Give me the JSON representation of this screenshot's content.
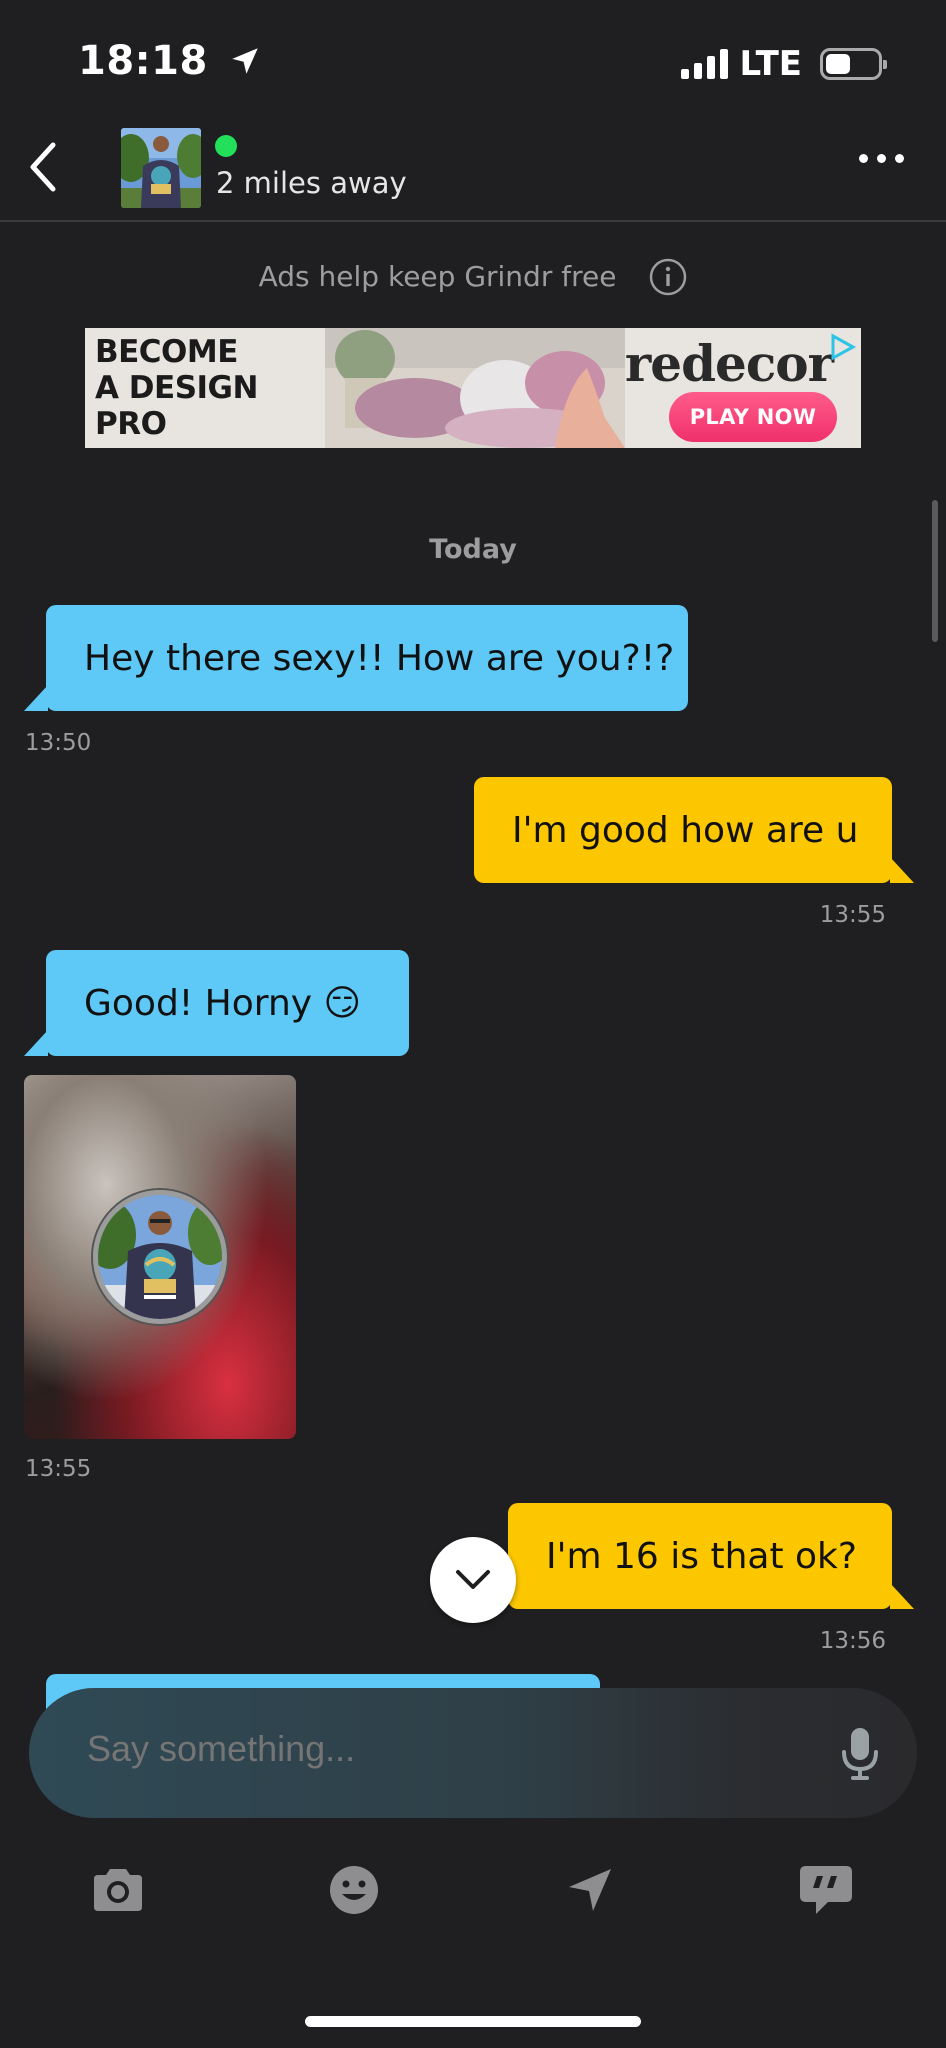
{
  "status_bar": {
    "time": "18:18",
    "network": "LTE"
  },
  "header": {
    "distance": "2 miles away",
    "online_color": "#22e05a"
  },
  "ad": {
    "note": "Ads help keep Grindr free",
    "headline": "BECOME\nA DESIGN\nPRO",
    "brand": "redecor",
    "cta": "PLAY NOW"
  },
  "chat": {
    "date_separator": "Today",
    "messages": [
      {
        "direction": "in",
        "text": "Hey there sexy!!  How are you?!?",
        "time": "13:50"
      },
      {
        "direction": "out",
        "text": "I'm good how are u",
        "time": "13:55"
      },
      {
        "direction": "in",
        "text": "Good!  Horny 😏",
        "time": ""
      },
      {
        "direction": "in",
        "type": "photo",
        "time": "13:55"
      },
      {
        "direction": "out",
        "text": "I'm 16 is that ok?",
        "time": "13:56"
      }
    ]
  },
  "composer": {
    "placeholder": "Say something..."
  },
  "colors": {
    "incoming_bubble": "#5ec8f6",
    "outgoing_bubble": "#fdc700",
    "background": "#1f1f21"
  },
  "toolbar_icons": [
    "camera-icon",
    "emoji-icon",
    "location-icon",
    "saved-phrases-icon"
  ]
}
